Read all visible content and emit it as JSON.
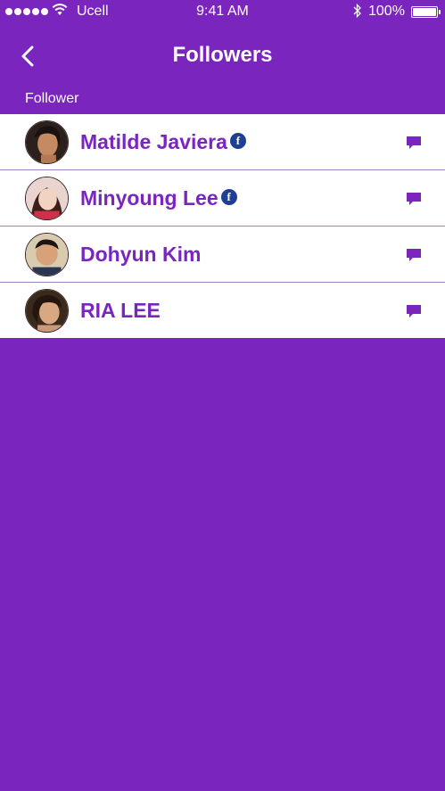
{
  "status_bar": {
    "carrier": "Ucell",
    "time": "9:41 AM",
    "battery": "100%"
  },
  "nav": {
    "title": "Followers",
    "back_icon": "chevron-left-icon"
  },
  "section": {
    "header": "Follower"
  },
  "followers": [
    {
      "name": "Matilde Javiera",
      "facebook": true
    },
    {
      "name": "Minyoung Lee",
      "facebook": true
    },
    {
      "name": "Dohyun Kim",
      "facebook": false
    },
    {
      "name": "RIA LEE",
      "facebook": false
    }
  ],
  "icons": {
    "facebook": "f",
    "message": "message-bubble-icon"
  },
  "colors": {
    "background": "#7a25bd",
    "accent": "#7a25bd",
    "facebook": "#1f3f95"
  }
}
